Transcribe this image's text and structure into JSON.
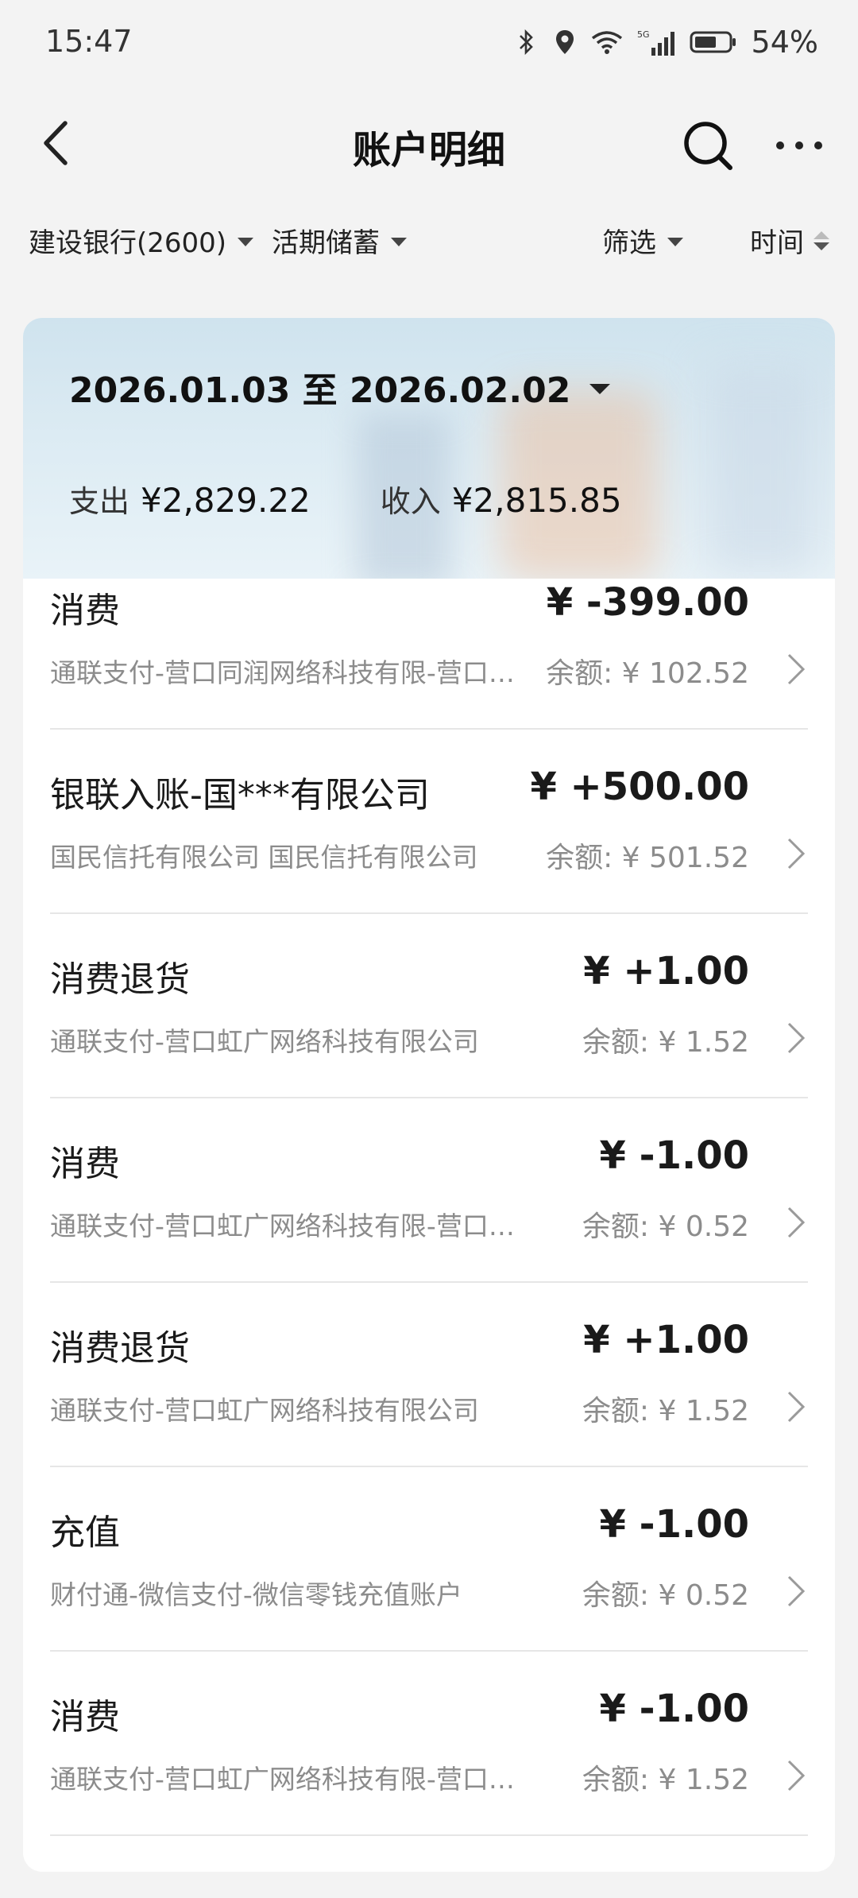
{
  "status": {
    "time": "15:47",
    "battery_percent": "54%",
    "icons": [
      "bluetooth-icon",
      "location-icon",
      "wifi-icon",
      "signal-5g-icon",
      "battery-icon"
    ]
  },
  "header": {
    "title": "账户明细",
    "back_icon": "back-chevron-icon",
    "search_icon": "search-icon",
    "more_icon": "more-dots-icon"
  },
  "filters": {
    "account": "建设银行(2600)",
    "account_type": "活期储蓄",
    "filter_label": "筛选",
    "sort_label": "时间"
  },
  "summary": {
    "date_range": "2026.01.03 至 2026.02.02",
    "expense_label": "支出",
    "expense_value": "¥2,829.22",
    "income_label": "收入",
    "income_value": "¥2,815.85"
  },
  "transactions": [
    {
      "title": "消费",
      "amount": "¥ -399.00",
      "desc": "通联支付-营口同润网络科技有限-营口同润网络科技有限公司",
      "balance": "余额: ¥ 102.52"
    },
    {
      "title": "银联入账-国***有限公司",
      "amount": "¥ +500.00",
      "desc": "国民信托有限公司 国民信托有限公司",
      "balance": "余额: ¥ 501.52"
    },
    {
      "title": "消费退货",
      "amount": "¥ +1.00",
      "desc": "通联支付-营口虹广网络科技有限公司",
      "balance": "余额: ¥ 1.52"
    },
    {
      "title": "消费",
      "amount": "¥ -1.00",
      "desc": "通联支付-营口虹广网络科技有限-营口虹广网络科技有限公司",
      "balance": "余额: ¥ 0.52"
    },
    {
      "title": "消费退货",
      "amount": "¥ +1.00",
      "desc": "通联支付-营口虹广网络科技有限公司",
      "balance": "余额: ¥ 1.52"
    },
    {
      "title": "充值",
      "amount": "¥ -1.00",
      "desc": "财付通-微信支付-微信零钱充值账户",
      "balance": "余额: ¥ 0.52"
    },
    {
      "title": "消费",
      "amount": "¥ -1.00",
      "desc": "通联支付-营口虹广网络科技有限-营口虹广网络科技有限公司",
      "balance": "余额: ¥ 1.52"
    }
  ]
}
